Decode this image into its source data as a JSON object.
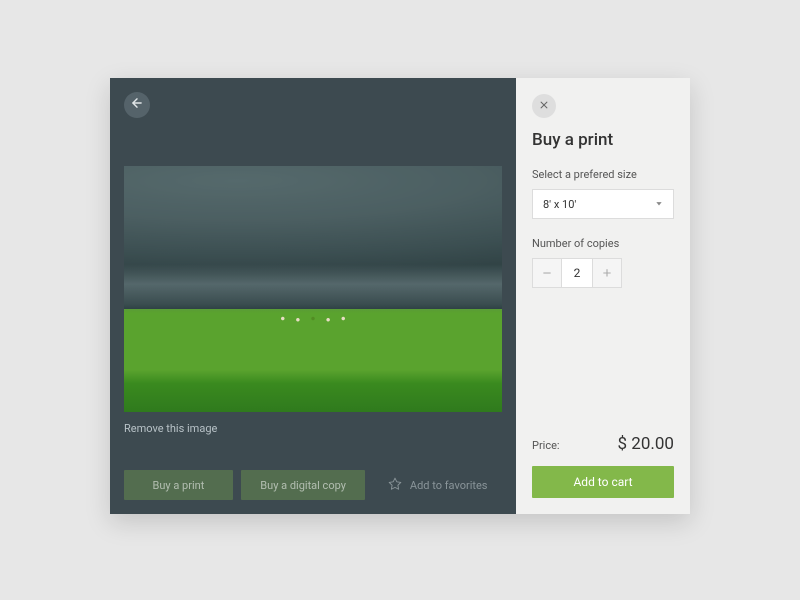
{
  "viewer": {
    "remove_label": "Remove this image",
    "actions": {
      "buy_print": "Buy a print",
      "buy_digital": "Buy a digital copy",
      "favorite": "Add to favorites"
    }
  },
  "panel": {
    "title": "Buy a print",
    "size_label": "Select a prefered size",
    "size_value": "8' x 10'",
    "copies_label": "Number of copies",
    "copies_value": "2",
    "price_label": "Price:",
    "price_value": "$ 20.00",
    "add_cart_label": "Add to cart"
  },
  "icons": {
    "back": "arrow-left",
    "close": "x",
    "star": "star-outline",
    "caret": "chevron-down",
    "minus": "minus",
    "plus": "plus"
  },
  "colors": {
    "viewer_bg": "#3d4a50",
    "panel_bg": "#f1f1f0",
    "accent": "#83b84a"
  }
}
